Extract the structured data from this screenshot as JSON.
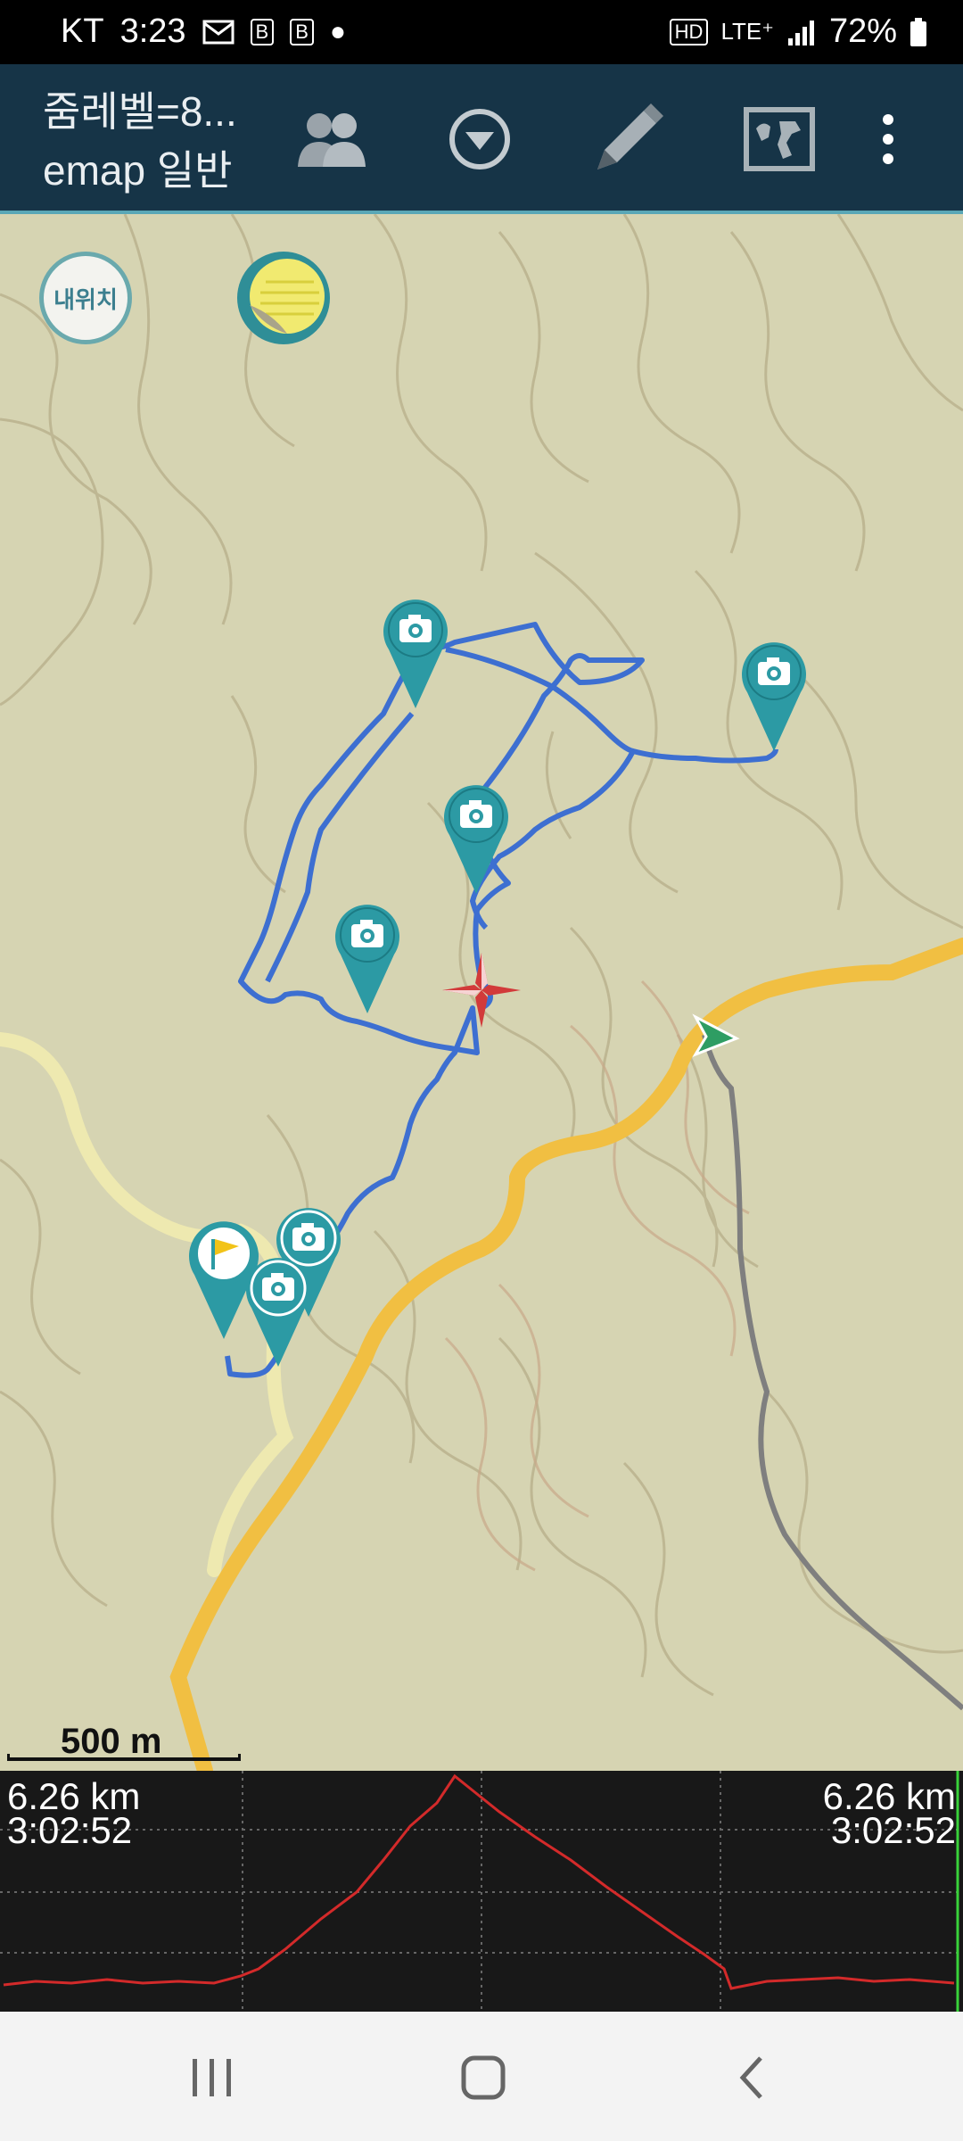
{
  "status_bar": {
    "carrier": "KT",
    "time": "3:23",
    "indicators_left": [
      "mail-icon",
      "b-icon",
      "b-icon",
      "dot-icon"
    ],
    "network": "LTE⁺",
    "hd": "HD",
    "battery": "72%"
  },
  "app_bar": {
    "title": "줌레벨=8...",
    "subtitle": "emap 일반",
    "actions": [
      "group-icon",
      "dropdown-icon",
      "pencil-icon",
      "world-map-icon",
      "more-vert-icon"
    ]
  },
  "map": {
    "my_location_label": "내위치",
    "scale_label": "500 m",
    "photo_markers": 6,
    "start_flag_marker": 1,
    "colors": {
      "track": "#3d6fd1",
      "marker": "#2c9aa4",
      "road_main": "#f1bf42",
      "road_minor": "#eee9b0",
      "path_grey": "#808080"
    }
  },
  "profile": {
    "left_distance": "6.26 km",
    "left_time": "3:02:52",
    "right_distance": "6.26 km",
    "right_time": "3:02:52",
    "line_color": "#d32a2a"
  },
  "nav_bar": {
    "buttons": [
      "recents-icon",
      "home-icon",
      "back-icon"
    ]
  }
}
